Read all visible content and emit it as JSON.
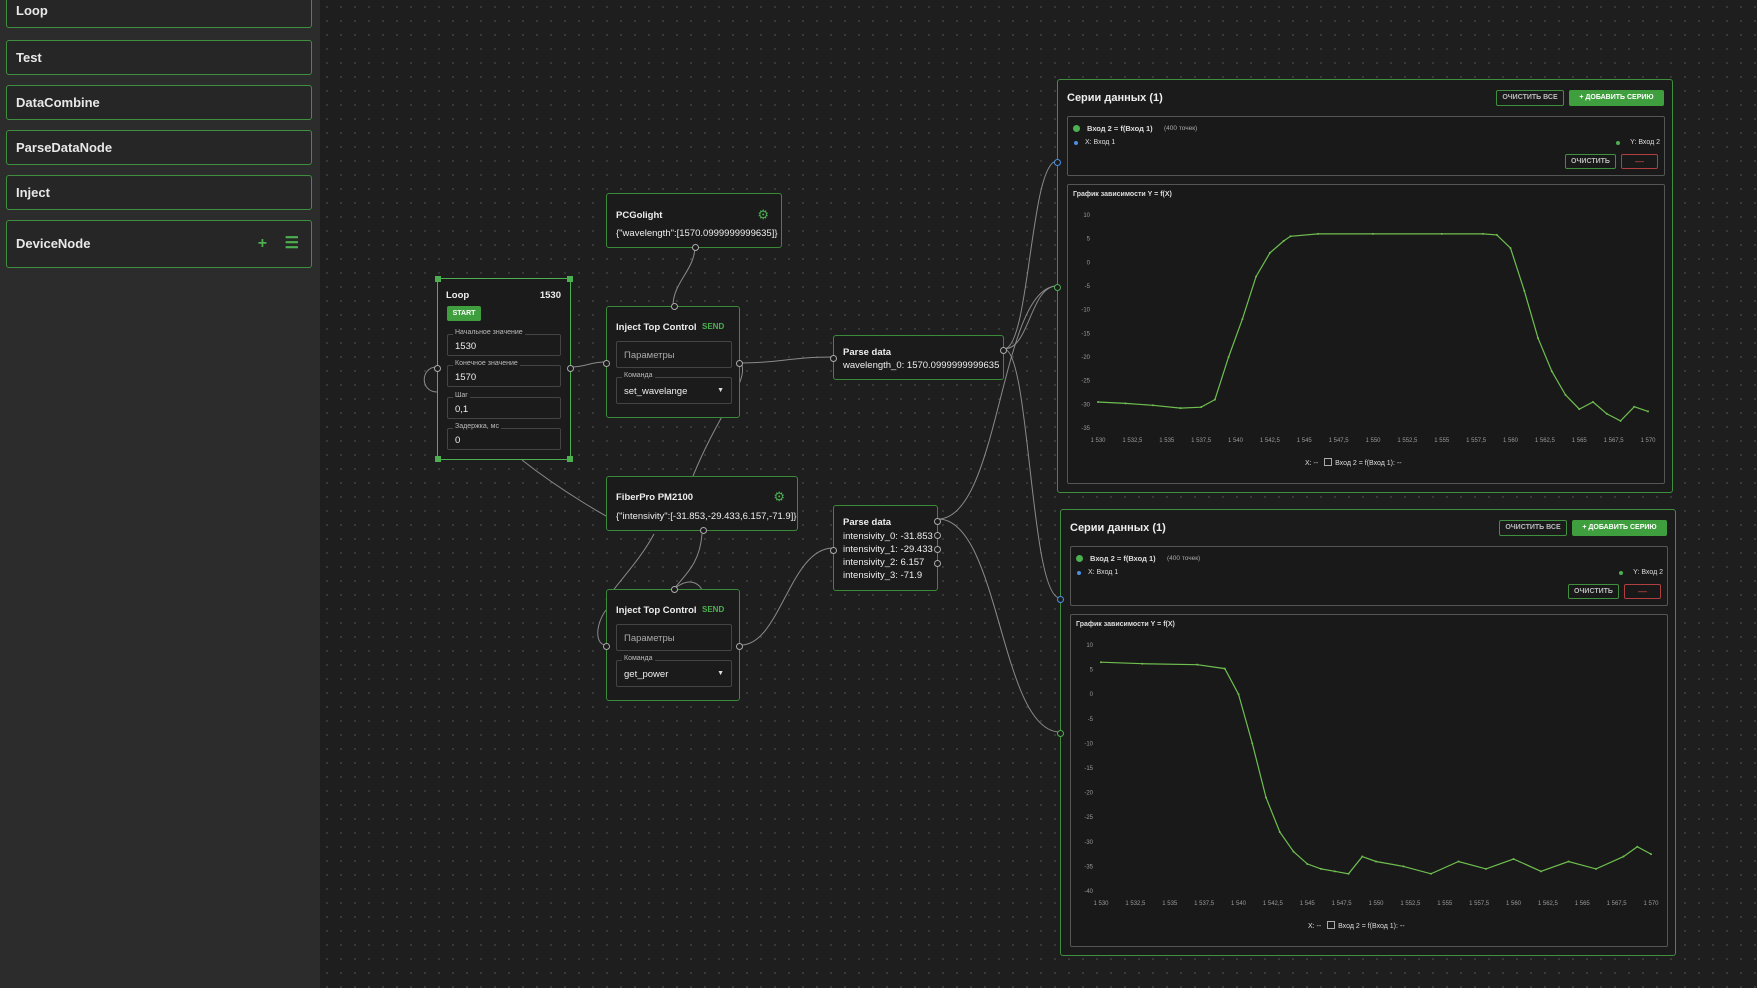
{
  "sidebar": {
    "items": [
      {
        "label": "Loop"
      },
      {
        "label": "Test"
      },
      {
        "label": "DataCombine"
      },
      {
        "label": "ParseDataNode"
      },
      {
        "label": "Inject"
      },
      {
        "label": "DeviceNode"
      }
    ],
    "device_actions": [
      "plus-icon",
      "list-icon"
    ]
  },
  "nodes": {
    "loop": {
      "title": "Loop",
      "current_value": "1530",
      "start_label": "START",
      "fields": [
        {
          "label": "Начальное значение",
          "value": "1530"
        },
        {
          "label": "Конечное значение",
          "value": "1570"
        },
        {
          "label": "Шаг",
          "value": "0,1"
        },
        {
          "label": "Задержка, мс",
          "value": "0"
        }
      ]
    },
    "pcgolight": {
      "title": "PCGolight",
      "output": "{\"wavelength\":[1570.0999999999635]}"
    },
    "inject1": {
      "title": "Inject Top Control",
      "send_label": "SEND",
      "params_placeholder": "Параметры",
      "command_label": "Команда",
      "command_value": "set_wavelange"
    },
    "parse1": {
      "title": "Parse data",
      "lines": [
        "wavelength_0: 1570.0999999999635"
      ]
    },
    "fiberpro": {
      "title": "FiberPro PM2100",
      "output": "{\"intensivity\":[-31.853,-29.433,6.157,-71.9]}"
    },
    "parse2": {
      "title": "Parse data",
      "lines": [
        "intensivity_0: -31.853",
        "intensivity_1: -29.433",
        "intensivity_2: 6.157",
        "intensivity_3: -71.9"
      ]
    },
    "inject2": {
      "title": "Inject Top Control",
      "send_label": "SEND",
      "params_placeholder": "Параметры",
      "command_label": "Команда",
      "command_value": "get_power"
    }
  },
  "panels": [
    {
      "title": "Серии данных (1)",
      "clear_all": "ОЧИСТИТЬ ВСЕ",
      "add_series": "ДОБАВИТЬ СЕРИЮ",
      "series_name": "Вход 2 = f(Вход 1)",
      "series_points": "(400 точек)",
      "x_input": "X: Вход 1",
      "y_input": "Y: Вход 2",
      "clear": "ОЧИСТИТЬ",
      "remove": "—",
      "chart_title": "График зависимости Y = f(X)",
      "legend_x": "X: --",
      "legend_series": "Вход 2 = f(Вход 1): --"
    },
    {
      "title": "Серии данных (1)",
      "clear_all": "ОЧИСТИТЬ ВСЕ",
      "add_series": "ДОБАВИТЬ СЕРИЮ",
      "series_name": "Вход 2 = f(Вход 1)",
      "series_points": "(400 точек)",
      "x_input": "X: Вход 1",
      "y_input": "Y: Вход 2",
      "clear": "ОЧИСТИТЬ",
      "remove": "—",
      "chart_title": "График зависимости Y = f(X)",
      "legend_x": "X: --",
      "legend_series": "Вход 2 = f(Вход 1): --"
    }
  ],
  "colors": {
    "accent": "#4caf50",
    "line": "#6fbf4f",
    "node_border": "#3a8a3a",
    "background": "#1e1e1e",
    "sidebar": "#2c2c2c"
  },
  "chart_data": [
    {
      "type": "line",
      "title": "График зависимости Y = f(X)",
      "xlabel": "",
      "ylabel": "",
      "xlim": [
        1530,
        1570
      ],
      "ylim": [
        -35,
        10
      ],
      "x_ticks": [
        "1 530",
        "1 532,5",
        "1 535",
        "1 537,5",
        "1 540",
        "1 542,5",
        "1 545",
        "1 547,5",
        "1 550",
        "1 552,5",
        "1 555",
        "1 557,5",
        "1 560",
        "1 562,5",
        "1 565",
        "1 567,5",
        "1 570"
      ],
      "y_ticks": [
        "10",
        "5",
        "0",
        "-5",
        "-10",
        "-15",
        "-20",
        "-25",
        "-30",
        "-35"
      ],
      "legend": "bottom",
      "series": [
        {
          "name": "Вход 2 = f(Вход 1)",
          "x": [
            1530,
            1532,
            1534,
            1536,
            1537.5,
            1538.5,
            1539.5,
            1540.5,
            1541.5,
            1542.5,
            1543.5,
            1544,
            1546,
            1550,
            1555,
            1558,
            1559,
            1560,
            1561,
            1562,
            1563,
            1564,
            1565,
            1566,
            1567,
            1568,
            1569,
            1570
          ],
          "y": [
            -29.5,
            -29.8,
            -30.2,
            -30.8,
            -30.6,
            -29,
            -20,
            -12,
            -3,
            2,
            4.5,
            5.5,
            6,
            6,
            6,
            6,
            5.8,
            3,
            -6,
            -16,
            -23,
            -28,
            -31,
            -29.5,
            -32,
            -33.5,
            -30.5,
            -31.5
          ]
        }
      ]
    },
    {
      "type": "line",
      "title": "График зависимости Y = f(X)",
      "xlabel": "",
      "ylabel": "",
      "xlim": [
        1530,
        1570
      ],
      "ylim": [
        -40,
        10
      ],
      "x_ticks": [
        "1 530",
        "1 532,5",
        "1 535",
        "1 537,5",
        "1 540",
        "1 542,5",
        "1 545",
        "1 547,5",
        "1 550",
        "1 552,5",
        "1 555",
        "1 557,5",
        "1 560",
        "1 562,5",
        "1 565",
        "1 567,5",
        "1 570"
      ],
      "y_ticks": [
        "10",
        "5",
        "0",
        "-5",
        "-10",
        "-15",
        "-20",
        "-25",
        "-30",
        "-35",
        "-40"
      ],
      "legend": "bottom",
      "series": [
        {
          "name": "Вход 2 = f(Вход 1)",
          "x": [
            1530,
            1533,
            1537,
            1539,
            1540,
            1541,
            1542,
            1543,
            1544,
            1545,
            1546,
            1547,
            1548,
            1549,
            1550,
            1552,
            1554,
            1556,
            1558,
            1560,
            1562,
            1564,
            1566,
            1568,
            1569,
            1570
          ],
          "y": [
            6.5,
            6.2,
            6,
            5.2,
            0,
            -10,
            -21,
            -28,
            -32,
            -34.5,
            -35.5,
            -36,
            -36.5,
            -33,
            -34,
            -35,
            -36.5,
            -34,
            -35.5,
            -33.5,
            -36,
            -34,
            -35.5,
            -33,
            -31,
            -32.5
          ]
        }
      ]
    }
  ]
}
